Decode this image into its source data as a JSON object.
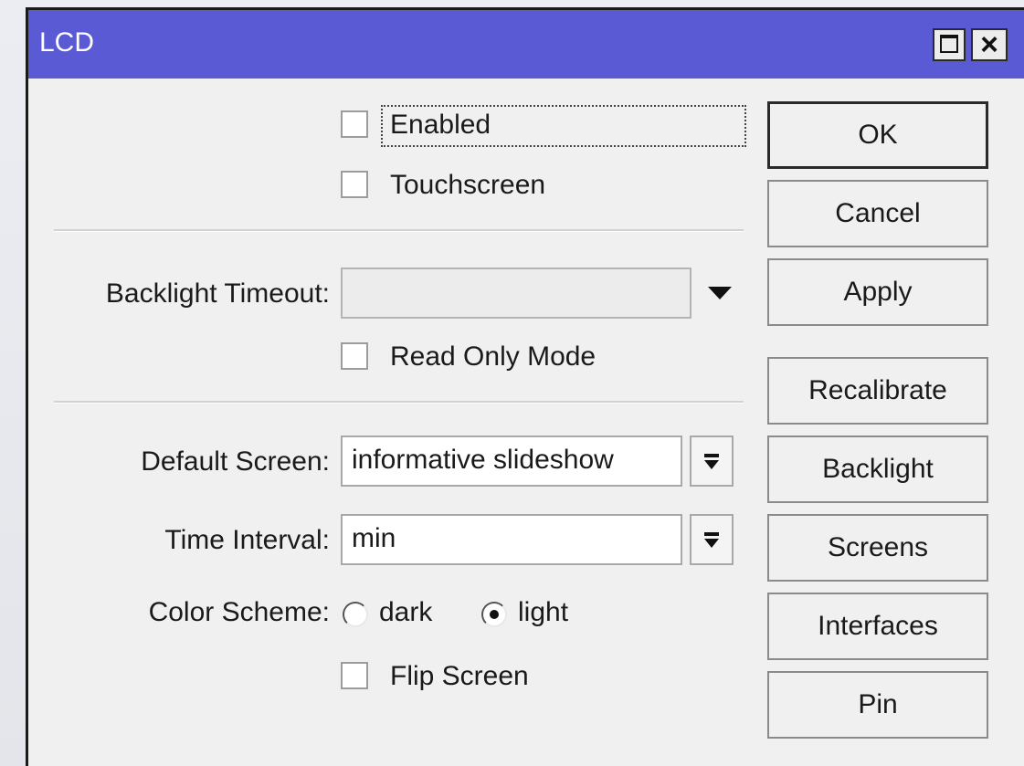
{
  "window": {
    "title": "LCD",
    "maximize_icon": "maximize-icon",
    "close_icon": "close-icon"
  },
  "form": {
    "enabled": {
      "label": "Enabled",
      "checked": false
    },
    "touchscreen": {
      "label": "Touchscreen",
      "checked": false
    },
    "backlight_timeout": {
      "label": "Backlight Timeout:",
      "value": "",
      "disabled": true
    },
    "read_only_mode": {
      "label": "Read Only Mode",
      "checked": false
    },
    "default_screen": {
      "label": "Default Screen:",
      "value": "informative slideshow"
    },
    "time_interval": {
      "label": "Time Interval:",
      "value": "min"
    },
    "color_scheme": {
      "label": "Color Scheme:",
      "options": [
        "dark",
        "light"
      ],
      "selected": "light"
    },
    "flip_screen": {
      "label": "Flip Screen",
      "checked": false
    }
  },
  "buttons": {
    "ok": "OK",
    "cancel": "Cancel",
    "apply": "Apply",
    "recalibrate": "Recalibrate",
    "backlight": "Backlight",
    "screens": "Screens",
    "interfaces": "Interfaces",
    "pin": "Pin"
  },
  "colors": {
    "titlebar": "#5a5ad4",
    "window_bg": "#f0f0f0"
  }
}
